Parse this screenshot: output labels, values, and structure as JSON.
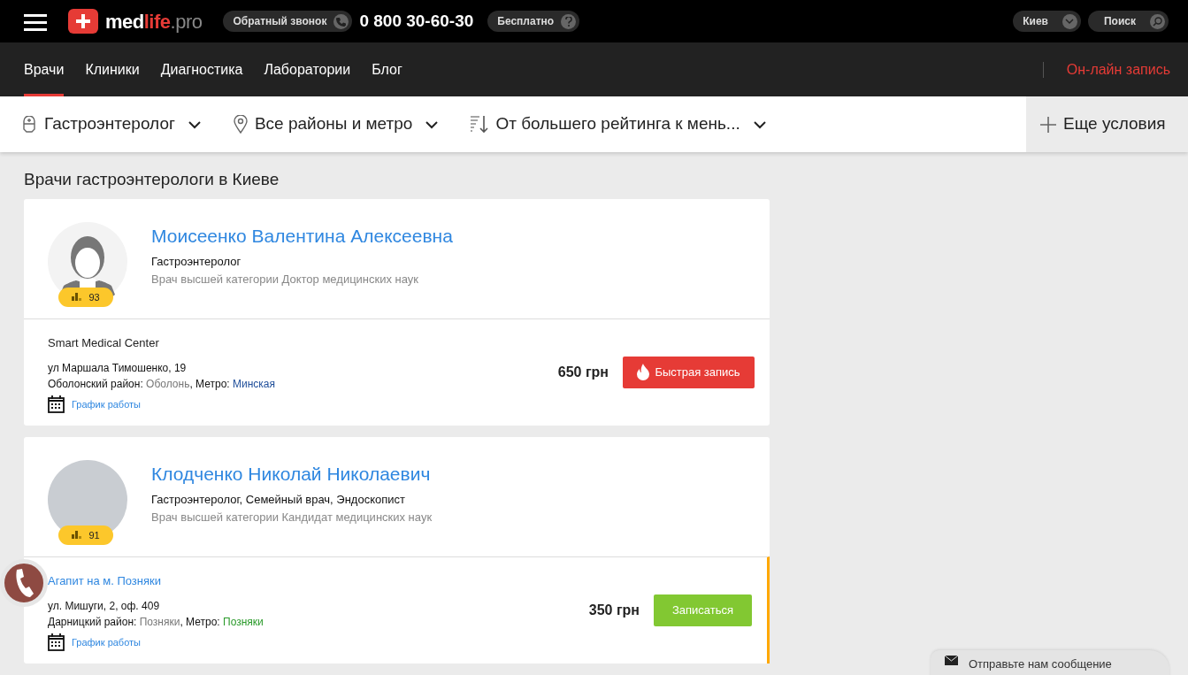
{
  "header": {
    "logo": {
      "med": "med",
      "life": "life",
      "pro": ".pro"
    },
    "callback": "Обратный звонок",
    "phone": "0 800 30-60-30",
    "free": "Бесплатно",
    "city": "Киев",
    "search": "Поиск"
  },
  "nav": {
    "items": [
      {
        "label": "Врачи",
        "selected": true
      },
      {
        "label": "Клиники",
        "selected": false
      },
      {
        "label": "Диагностика",
        "selected": false
      },
      {
        "label": "Лаборатории",
        "selected": false
      },
      {
        "label": "Блог",
        "selected": false
      }
    ],
    "online": "Он-лайн запись"
  },
  "filters": [
    {
      "kind": "specialty",
      "label": "Гастроэнтеролог"
    },
    {
      "kind": "location",
      "label": "Все районы и метро"
    },
    {
      "kind": "sort",
      "label": "От большего рейтинга к мень..."
    }
  ],
  "more_filters": "Еще условия",
  "heading": "Врачи гастроэнтерологи в Киеве",
  "doctors": [
    {
      "name": "Моисеенко Валентина Алексеевна",
      "specialty": "Гастроэнтеролог",
      "category": "Врач высшей категории Доктор медицинских наук",
      "avatar": {
        "kind": "silhouette"
      },
      "rating": "93",
      "clinic": {
        "name": "Smart Medical Center",
        "address": "ул Маршала Тимошенко, 19",
        "district": "Оболонский район:",
        "area": "Оболонь",
        "metro_label": ", Метро:",
        "metro": {
          "name": "Минская",
          "color": "#1f4e9a"
        },
        "schedule": "График работы",
        "highlighted": false
      },
      "price": "650 грн",
      "button": {
        "kind": "quick",
        "label": "Быстрая запись"
      }
    },
    {
      "name": "Клодченко Николай Николаевич",
      "specialty": "Гастроэнтеролог, Семейный врач, Эндоскопист",
      "category": "Врач высшей категории Кандидат медицинских наук",
      "avatar": {
        "kind": "photo"
      },
      "rating": "91",
      "clinic": {
        "name": "Агапит на м. Позняки",
        "address": "ул. Мишуги, 2, оф. 409",
        "district": "Дарницкий район:",
        "area": "Позняки",
        "metro_label": ", Метро:",
        "metro": {
          "name": "Позняки",
          "color": "#2a9a2a"
        },
        "schedule": "График работы",
        "highlighted": true
      },
      "price": "350 грн",
      "button": {
        "kind": "regular",
        "label": "Записаться"
      }
    }
  ],
  "message_widget": "Отправьте нам сообщение"
}
